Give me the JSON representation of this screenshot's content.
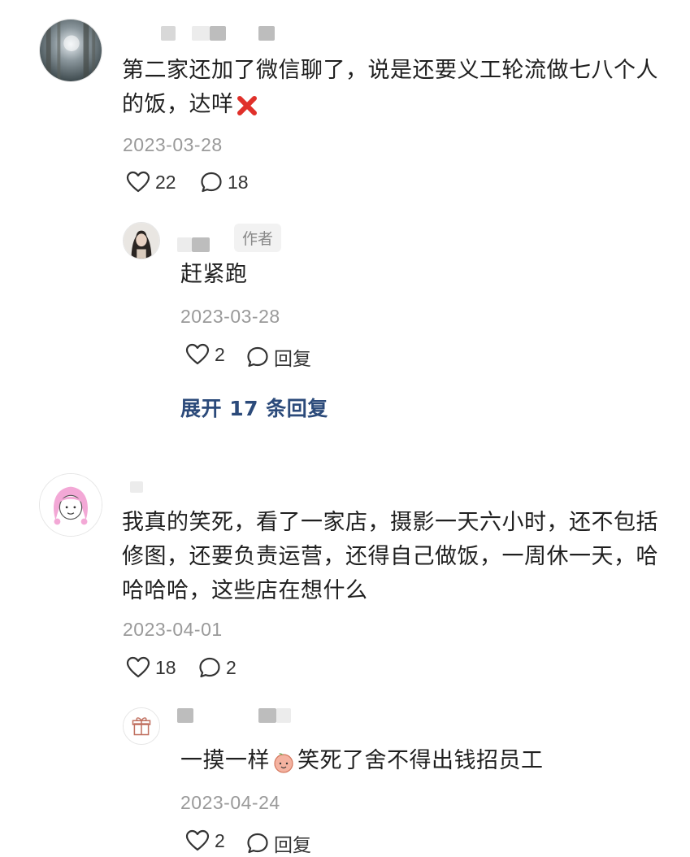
{
  "comments": [
    {
      "text_before_emoji": "第二家还加了微信聊了，说是还要义工轮流做七八个人的饭，达咩",
      "emoji": "cross-mark-emoji",
      "date": "2023-03-28",
      "likes": "22",
      "replies_count": "18",
      "reply": {
        "badge": "作者",
        "text": "赶紧跑",
        "date": "2023-03-28",
        "likes": "2",
        "reply_label": "回复"
      },
      "expand_label": "展开 17 条回复"
    },
    {
      "text": "我真的笑死，看了一家店，摄影一天六小时，还不包括修图，还要负责运营，还得自己做饭，一周休一天，哈哈哈哈，这些店在想什么",
      "date": "2023-04-01",
      "likes": "18",
      "replies_count": "2",
      "reply": {
        "text_before_emoji": "一摸一样",
        "emoji": "peach-emoji",
        "text_after_emoji": "笑死了舍不得出钱招员工",
        "date": "2023-04-24",
        "likes": "2",
        "reply_label": "回复"
      }
    }
  ],
  "colors": {
    "link": "#2b4a7a",
    "date": "#9a9a9a",
    "text": "#1f1f1f",
    "badge_bg": "#f2f2f2"
  }
}
